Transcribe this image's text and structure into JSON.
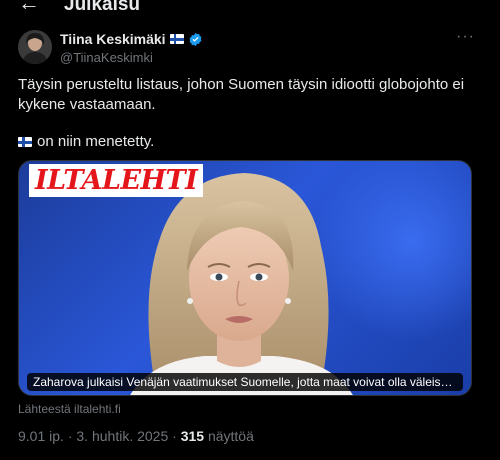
{
  "topbar": {
    "back_icon": "arrow-left-icon",
    "title": "Julkaisu"
  },
  "author": {
    "name": "Tiina Keskimäki",
    "handle": "@TiinaKeskimki",
    "flag_icon": "finland-flag-icon",
    "verified_icon": "verified-badge-icon",
    "more_icon": "more-options-icon"
  },
  "tweet": {
    "text": "Täysin perusteltu listaus, johon Suomen täysin idiootti globojohto ei kykene vastaamaan.",
    "line2_text": "on niin menetetty."
  },
  "card": {
    "brand": "ILTALEHTI",
    "caption": "Zaharova julkaisi Venäjän vaatimukset Suomelle, jotta maat voivat olla väleissä: Lue ko...",
    "source": "Lähteestä iltalehti.fi"
  },
  "meta": {
    "time": "9.01 ip.",
    "separator": "·",
    "date": "3. huhtik. 2025",
    "views_count": "315",
    "views_label": "näyttöä"
  },
  "colors": {
    "background": "#000000",
    "text": "#e7e9ea",
    "muted": "#71767b",
    "verified": "#1d9bf0",
    "brand_red": "#e4151b",
    "card_blue": "#2a57d8"
  }
}
